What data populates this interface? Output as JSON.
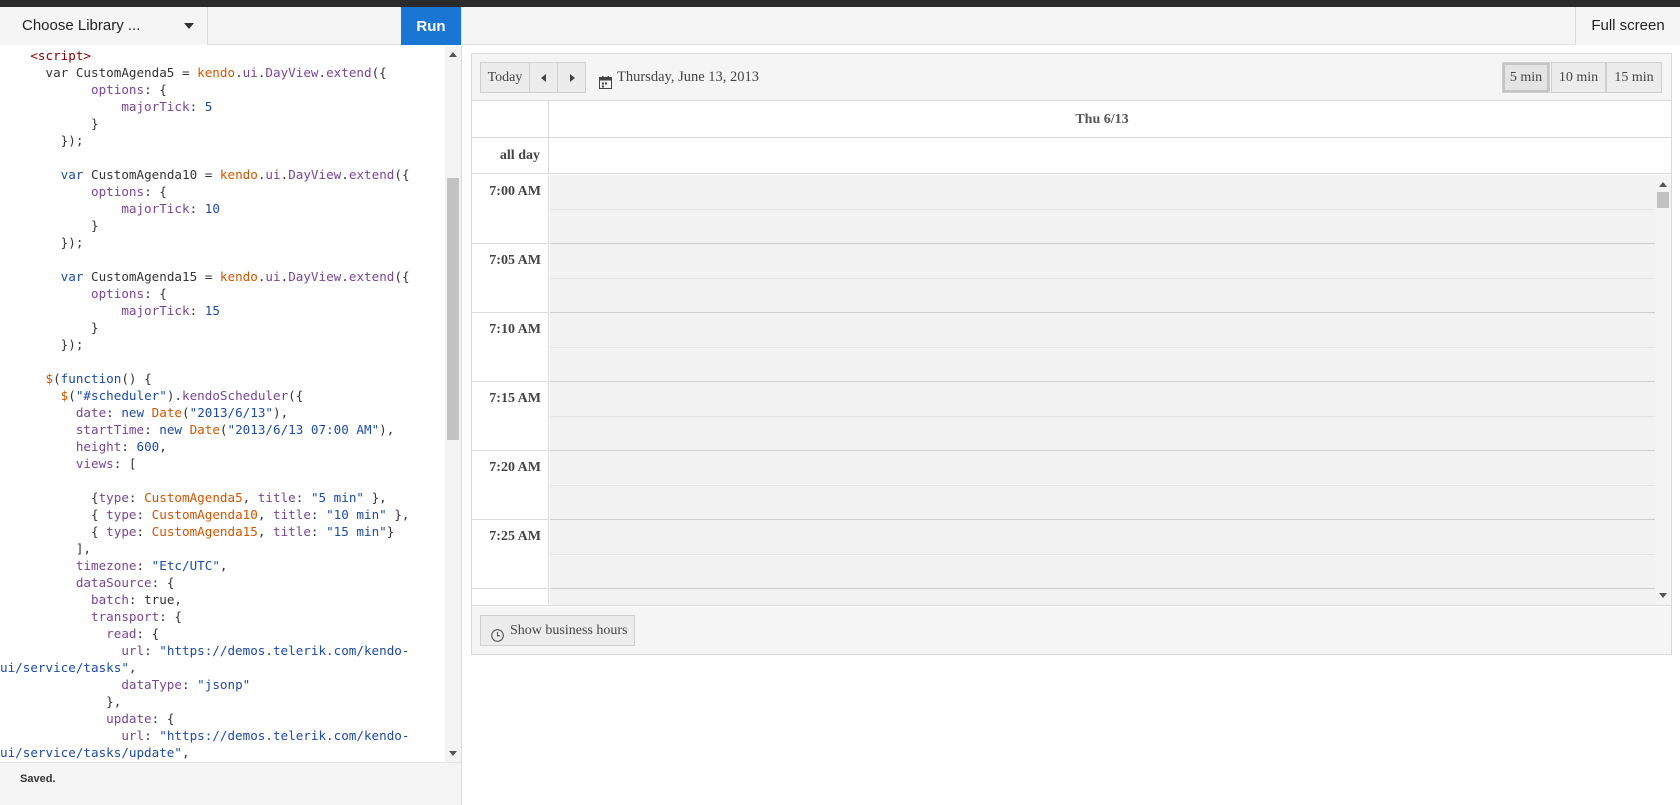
{
  "toolbar": {
    "library_select_label": "Choose Library ...",
    "run_label": "Run",
    "fullscreen_label": "Full screen",
    "run_color": "#1976d2"
  },
  "editor": {
    "status_text": "Saved.",
    "code_lines": [
      [
        [
          "tag",
          "    <script>"
        ]
      ],
      [
        [
          "var",
          "      var CustomAgenda5 = "
        ],
        [
          "obj",
          "kendo"
        ],
        [
          "pun",
          "."
        ],
        [
          "prop",
          "ui"
        ],
        [
          "pun",
          "."
        ],
        [
          "prop",
          "DayView"
        ],
        [
          "pun",
          "."
        ],
        [
          "prop",
          "extend"
        ],
        [
          "pun",
          "({"
        ]
      ],
      [
        [
          "prop",
          "            options"
        ],
        [
          "pun",
          ": {"
        ]
      ],
      [
        [
          "prop",
          "                majorTick"
        ],
        [
          "pun",
          ": "
        ],
        [
          "num",
          "5"
        ]
      ],
      [
        [
          "pun",
          "            }"
        ]
      ],
      [
        [
          "pun",
          "        });"
        ]
      ],
      [
        [
          "pun",
          ""
        ]
      ],
      [
        [
          "kw",
          "        var "
        ],
        [
          "var",
          "CustomAgenda10 = "
        ],
        [
          "obj",
          "kendo"
        ],
        [
          "pun",
          "."
        ],
        [
          "prop",
          "ui"
        ],
        [
          "pun",
          "."
        ],
        [
          "prop",
          "DayView"
        ],
        [
          "pun",
          "."
        ],
        [
          "prop",
          "extend"
        ],
        [
          "pun",
          "({"
        ]
      ],
      [
        [
          "prop",
          "            options"
        ],
        [
          "pun",
          ": {"
        ]
      ],
      [
        [
          "prop",
          "                majorTick"
        ],
        [
          "pun",
          ": "
        ],
        [
          "num",
          "10"
        ]
      ],
      [
        [
          "pun",
          "            }"
        ]
      ],
      [
        [
          "pun",
          "        });"
        ]
      ],
      [
        [
          "pun",
          ""
        ]
      ],
      [
        [
          "kw",
          "        var "
        ],
        [
          "var",
          "CustomAgenda15 = "
        ],
        [
          "obj",
          "kendo"
        ],
        [
          "pun",
          "."
        ],
        [
          "prop",
          "ui"
        ],
        [
          "pun",
          "."
        ],
        [
          "prop",
          "DayView"
        ],
        [
          "pun",
          "."
        ],
        [
          "prop",
          "extend"
        ],
        [
          "pun",
          "({"
        ]
      ],
      [
        [
          "prop",
          "            options"
        ],
        [
          "pun",
          ": {"
        ]
      ],
      [
        [
          "prop",
          "                majorTick"
        ],
        [
          "pun",
          ": "
        ],
        [
          "num",
          "15"
        ]
      ],
      [
        [
          "pun",
          "            }"
        ]
      ],
      [
        [
          "pun",
          "        });"
        ]
      ],
      [
        [
          "pun",
          ""
        ]
      ],
      [
        [
          "fn",
          "      $"
        ],
        [
          "pun",
          "("
        ],
        [
          "kw",
          "function"
        ],
        [
          "pun",
          "() {"
        ]
      ],
      [
        [
          "fn",
          "        $"
        ],
        [
          "pun",
          "("
        ],
        [
          "str",
          "\"#scheduler\""
        ],
        [
          "pun",
          ")."
        ],
        [
          "prop",
          "kendoScheduler"
        ],
        [
          "pun",
          "({"
        ]
      ],
      [
        [
          "prop",
          "          date"
        ],
        [
          "pun",
          ": "
        ],
        [
          "kw",
          "new "
        ],
        [
          "fn",
          "Date"
        ],
        [
          "pun",
          "("
        ],
        [
          "str",
          "\"2013/6/13\""
        ],
        [
          "pun",
          "),"
        ]
      ],
      [
        [
          "prop",
          "          startTime"
        ],
        [
          "pun",
          ": "
        ],
        [
          "kw",
          "new "
        ],
        [
          "fn",
          "Date"
        ],
        [
          "pun",
          "("
        ],
        [
          "str",
          "\"2013/6/13 07:00 AM\""
        ],
        [
          "pun",
          "),"
        ]
      ],
      [
        [
          "prop",
          "          height"
        ],
        [
          "pun",
          ": "
        ],
        [
          "num",
          "600"
        ],
        [
          "pun",
          ","
        ]
      ],
      [
        [
          "prop",
          "          views"
        ],
        [
          "pun",
          ": ["
        ]
      ],
      [
        [
          "pun",
          ""
        ]
      ],
      [
        [
          "pun",
          "            {"
        ],
        [
          "prop",
          "type"
        ],
        [
          "pun",
          ": "
        ],
        [
          "obj",
          "CustomAgenda5"
        ],
        [
          "pun",
          ", "
        ],
        [
          "prop",
          "title"
        ],
        [
          "pun",
          ": "
        ],
        [
          "str",
          "\"5 min\""
        ],
        [
          "pun",
          " },"
        ]
      ],
      [
        [
          "pun",
          "            { "
        ],
        [
          "prop",
          "type"
        ],
        [
          "pun",
          ": "
        ],
        [
          "obj",
          "CustomAgenda10"
        ],
        [
          "pun",
          ", "
        ],
        [
          "prop",
          "title"
        ],
        [
          "pun",
          ": "
        ],
        [
          "str",
          "\"10 min\""
        ],
        [
          "pun",
          " },"
        ]
      ],
      [
        [
          "pun",
          "            { "
        ],
        [
          "prop",
          "type"
        ],
        [
          "pun",
          ": "
        ],
        [
          "obj",
          "CustomAgenda15"
        ],
        [
          "pun",
          ", "
        ],
        [
          "prop",
          "title"
        ],
        [
          "pun",
          ": "
        ],
        [
          "str",
          "\"15 min\""
        ],
        [
          "pun",
          "}"
        ]
      ],
      [
        [
          "pun",
          "          ],"
        ]
      ],
      [
        [
          "prop",
          "          timezone"
        ],
        [
          "pun",
          ": "
        ],
        [
          "str",
          "\"Etc/UTC\""
        ],
        [
          "pun",
          ","
        ]
      ],
      [
        [
          "prop",
          "          dataSource"
        ],
        [
          "pun",
          ": {"
        ]
      ],
      [
        [
          "prop",
          "            batch"
        ],
        [
          "pun",
          ": "
        ],
        [
          "var",
          "true"
        ],
        [
          "pun",
          ","
        ]
      ],
      [
        [
          "prop",
          "            transport"
        ],
        [
          "pun",
          ": {"
        ]
      ],
      [
        [
          "prop",
          "              read"
        ],
        [
          "pun",
          ": {"
        ]
      ],
      [
        [
          "prop",
          "                url"
        ],
        [
          "pun",
          ": "
        ],
        [
          "str",
          "\"https://demos.telerik.com/kendo-"
        ]
      ],
      [
        [
          "str",
          "ui/service/tasks\""
        ],
        [
          "pun",
          ","
        ]
      ],
      [
        [
          "prop",
          "                dataType"
        ],
        [
          "pun",
          ": "
        ],
        [
          "str",
          "\"jsonp\""
        ]
      ],
      [
        [
          "pun",
          "              },"
        ]
      ],
      [
        [
          "prop",
          "              update"
        ],
        [
          "pun",
          ": {"
        ]
      ],
      [
        [
          "prop",
          "                url"
        ],
        [
          "pun",
          ": "
        ],
        [
          "str",
          "\"https://demos.telerik.com/kendo-"
        ]
      ],
      [
        [
          "str",
          "ui/service/tasks/update\""
        ],
        [
          "pun",
          ","
        ]
      ]
    ]
  },
  "scheduler": {
    "today_label": "Today",
    "current_date": "Thursday, June 13, 2013",
    "views": [
      {
        "label": "5 min",
        "selected": true
      },
      {
        "label": "10 min",
        "selected": false
      },
      {
        "label": "15 min",
        "selected": false
      }
    ],
    "day_header": "Thu 6/13",
    "all_day_label": "all day",
    "time_slots": [
      "7:00 AM",
      "7:05 AM",
      "7:10 AM",
      "7:15 AM",
      "7:20 AM",
      "7:25 AM"
    ],
    "business_hours_label": "Show business hours"
  }
}
